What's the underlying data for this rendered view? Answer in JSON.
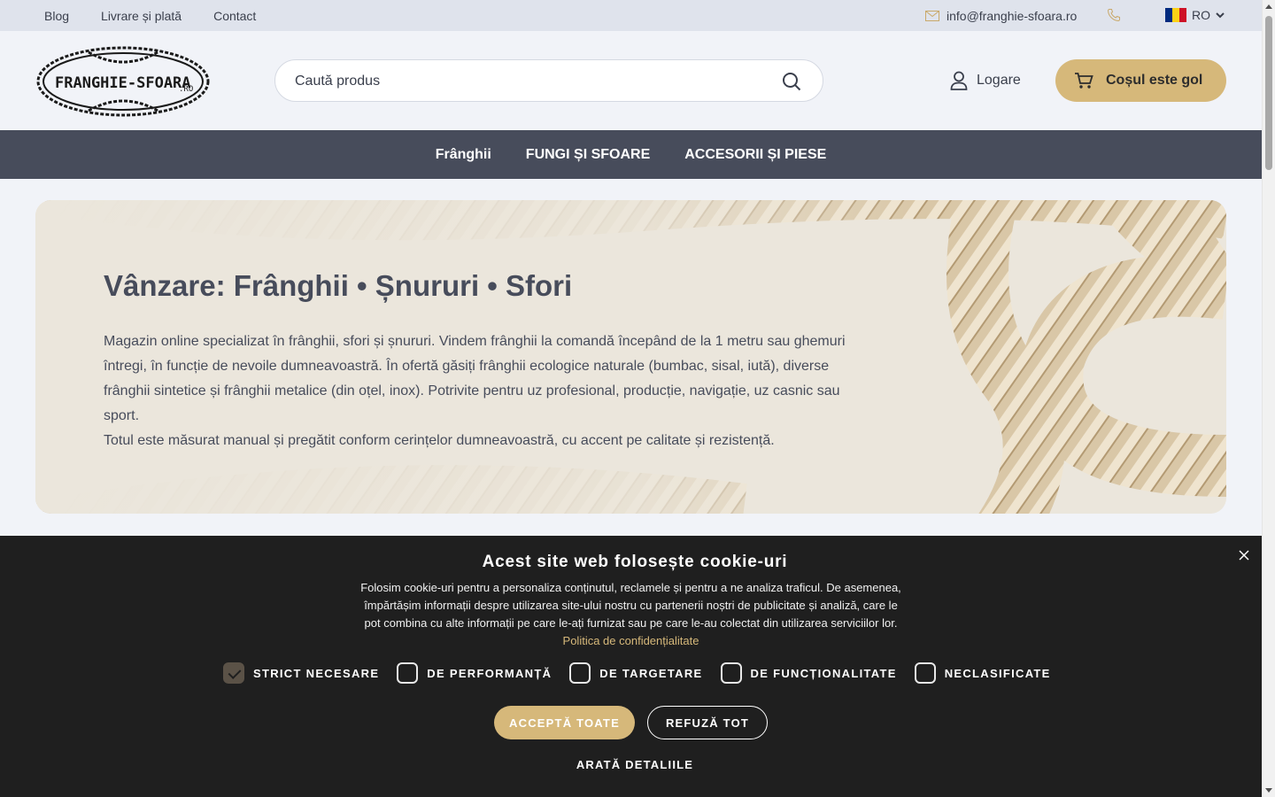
{
  "topbar": {
    "links": [
      "Blog",
      "Livrare și plată",
      "Contact"
    ],
    "email": "info@franghie-sfoara.ro",
    "language": "RO",
    "flag_colors": [
      "#002b7f",
      "#fcd116",
      "#ce1126"
    ]
  },
  "header": {
    "logo_text": "FRANGHIE-SFOARA",
    "logo_suffix": ".RO",
    "search_placeholder": "Caută produs",
    "login_label": "Logare",
    "cart_label": "Coșul este gol"
  },
  "nav": {
    "items": [
      "Frânghii",
      "FUNGI ȘI SFOARE",
      "ACCESORII ȘI PIESE"
    ]
  },
  "hero": {
    "title": "Vânzare: Frânghii • Șnururi • Sfori",
    "paragraph1": "Magazin online specializat în frânghii, sfori și șnururi. Vindem frânghii la comandă începând de la 1 metru sau ghemuri întregi, în funcție de nevoile dumneavoastră. În ofertă găsiți frânghii ecologice naturale (bumbac, sisal, iută), diverse frânghii sintetice și frânghii metalice (din oțel, inox). Potrivite pentru uz profesional, producție, navigație, uz casnic sau sport.",
    "paragraph2": "Totul este măsurat manual și pregătit conform cerințelor dumneavoastră, cu accent pe calitate și rezistență."
  },
  "cookie": {
    "title": "Acest site web folosește cookie-uri",
    "text": "Folosim cookie-uri pentru a personaliza conținutul, reclamele și pentru a ne analiza traficul. De asemenea, împărtășim informații despre utilizarea site-ului nostru cu partenerii noștri de publicitate și analiză, care le pot combina cu alte informații pe care le-ați furnizat sau pe care le-au colectat din utilizarea serviciilor lor.",
    "policy_link": "Politica de confidențialitate",
    "checkboxes": [
      {
        "label": "STRICT NECESARE",
        "checked": true
      },
      {
        "label": "DE PERFORMANȚĂ",
        "checked": false
      },
      {
        "label": "DE TARGETARE",
        "checked": false
      },
      {
        "label": "DE FUNCȚIONALITATE",
        "checked": false
      },
      {
        "label": "NECLASIFICATE",
        "checked": false
      }
    ],
    "accept_label": "ACCEPTĂ TOATE",
    "refuse_label": "REFUZĂ TOT",
    "details_label": "ARATĂ DETALIILE"
  },
  "colors": {
    "accent": "#d6b87a",
    "nav_bg": "#474c5b",
    "cookie_bg": "#1f1f1f"
  }
}
